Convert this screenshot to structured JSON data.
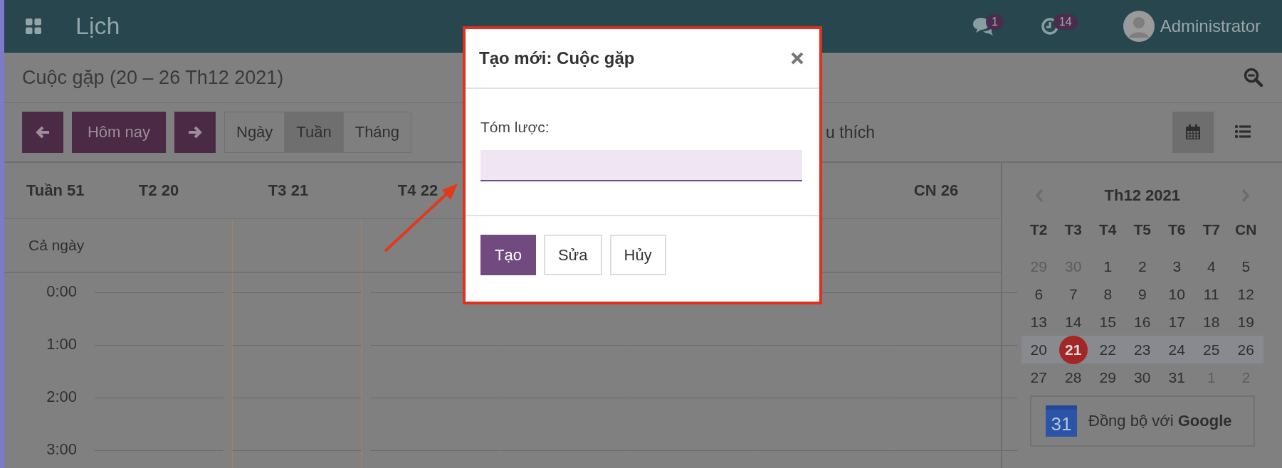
{
  "topbar": {
    "app_title": "Lịch",
    "messages_badge": "1",
    "activities_badge": "14",
    "user": "Administrator"
  },
  "breadcrumb": "Cuộc gặp (20 – 26 Th12 2021)",
  "toolbar": {
    "today_button": "Hôm nay",
    "scales": [
      {
        "label": "Ngày",
        "selected": false
      },
      {
        "label": "Tuần",
        "selected": true
      },
      {
        "label": "Tháng",
        "selected": false
      }
    ],
    "favorites_text": "u thích",
    "views": [
      {
        "kind": "calendar",
        "selected": true
      },
      {
        "kind": "list",
        "selected": false
      }
    ]
  },
  "week_view": {
    "week_label": "Tuần 51",
    "days": [
      {
        "label": "T2 20",
        "today": false
      },
      {
        "label": "T3 21",
        "today": true
      },
      {
        "label": "T4 22",
        "today": false
      },
      {
        "today": false
      },
      {
        "today": false
      },
      {
        "today": false
      },
      {
        "label": "CN 26",
        "today": false
      }
    ],
    "all_day_label": "Cả ngày",
    "hours": [
      "0:00",
      "1:00",
      "2:00",
      "3:00"
    ]
  },
  "mini_calendar": {
    "title": "Th12 2021",
    "weekdays": [
      "T2",
      "T3",
      "T4",
      "T5",
      "T6",
      "T7",
      "CN"
    ],
    "weeks": [
      {
        "current": false,
        "days": [
          {
            "label": "29",
            "other_month": true,
            "selected": false
          },
          {
            "label": "30",
            "other_month": true,
            "selected": false
          },
          {
            "label": "1",
            "other_month": false,
            "selected": false
          },
          {
            "label": "2",
            "other_month": false,
            "selected": false
          },
          {
            "label": "3",
            "other_month": false,
            "selected": false
          },
          {
            "label": "4",
            "other_month": false,
            "selected": false
          },
          {
            "label": "5",
            "other_month": false,
            "selected": false
          }
        ]
      },
      {
        "current": false,
        "days": [
          {
            "label": "6",
            "other_month": false,
            "selected": false
          },
          {
            "label": "7",
            "other_month": false,
            "selected": false
          },
          {
            "label": "8",
            "other_month": false,
            "selected": false
          },
          {
            "label": "9",
            "other_month": false,
            "selected": false
          },
          {
            "label": "10",
            "other_month": false,
            "selected": false
          },
          {
            "label": "11",
            "other_month": false,
            "selected": false
          },
          {
            "label": "12",
            "other_month": false,
            "selected": false
          }
        ]
      },
      {
        "current": false,
        "days": [
          {
            "label": "13",
            "other_month": false,
            "selected": false
          },
          {
            "label": "14",
            "other_month": false,
            "selected": false
          },
          {
            "label": "15",
            "other_month": false,
            "selected": false
          },
          {
            "label": "16",
            "other_month": false,
            "selected": false
          },
          {
            "label": "17",
            "other_month": false,
            "selected": false
          },
          {
            "label": "18",
            "other_month": false,
            "selected": false
          },
          {
            "label": "19",
            "other_month": false,
            "selected": false
          }
        ]
      },
      {
        "current": true,
        "days": [
          {
            "label": "20",
            "other_month": false,
            "selected": false
          },
          {
            "label": "21",
            "other_month": false,
            "selected": true
          },
          {
            "label": "22",
            "other_month": false,
            "selected": false
          },
          {
            "label": "23",
            "other_month": false,
            "selected": false
          },
          {
            "label": "24",
            "other_month": false,
            "selected": false
          },
          {
            "label": "25",
            "other_month": false,
            "selected": false
          },
          {
            "label": "26",
            "other_month": false,
            "selected": false
          }
        ]
      },
      {
        "current": false,
        "days": [
          {
            "label": "27",
            "other_month": false,
            "selected": false
          },
          {
            "label": "28",
            "other_month": false,
            "selected": false
          },
          {
            "label": "29",
            "other_month": false,
            "selected": false
          },
          {
            "label": "30",
            "other_month": false,
            "selected": false
          },
          {
            "label": "31",
            "other_month": false,
            "selected": false
          },
          {
            "label": "1",
            "other_month": true,
            "selected": false
          },
          {
            "label": "2",
            "other_month": true,
            "selected": false
          }
        ]
      }
    ]
  },
  "google_sync": {
    "icon_text": "31",
    "text": "Đồng bộ với **Google**"
  },
  "dialog": {
    "title": "Tạo mới: Cuộc gặp",
    "field_label": "Tóm lược:",
    "buttons": [
      {
        "label": "Tạo",
        "kind": "primary"
      },
      {
        "label": "Sửa",
        "kind": "secondary"
      },
      {
        "label": "Hủy",
        "kind": "secondary"
      }
    ]
  }
}
